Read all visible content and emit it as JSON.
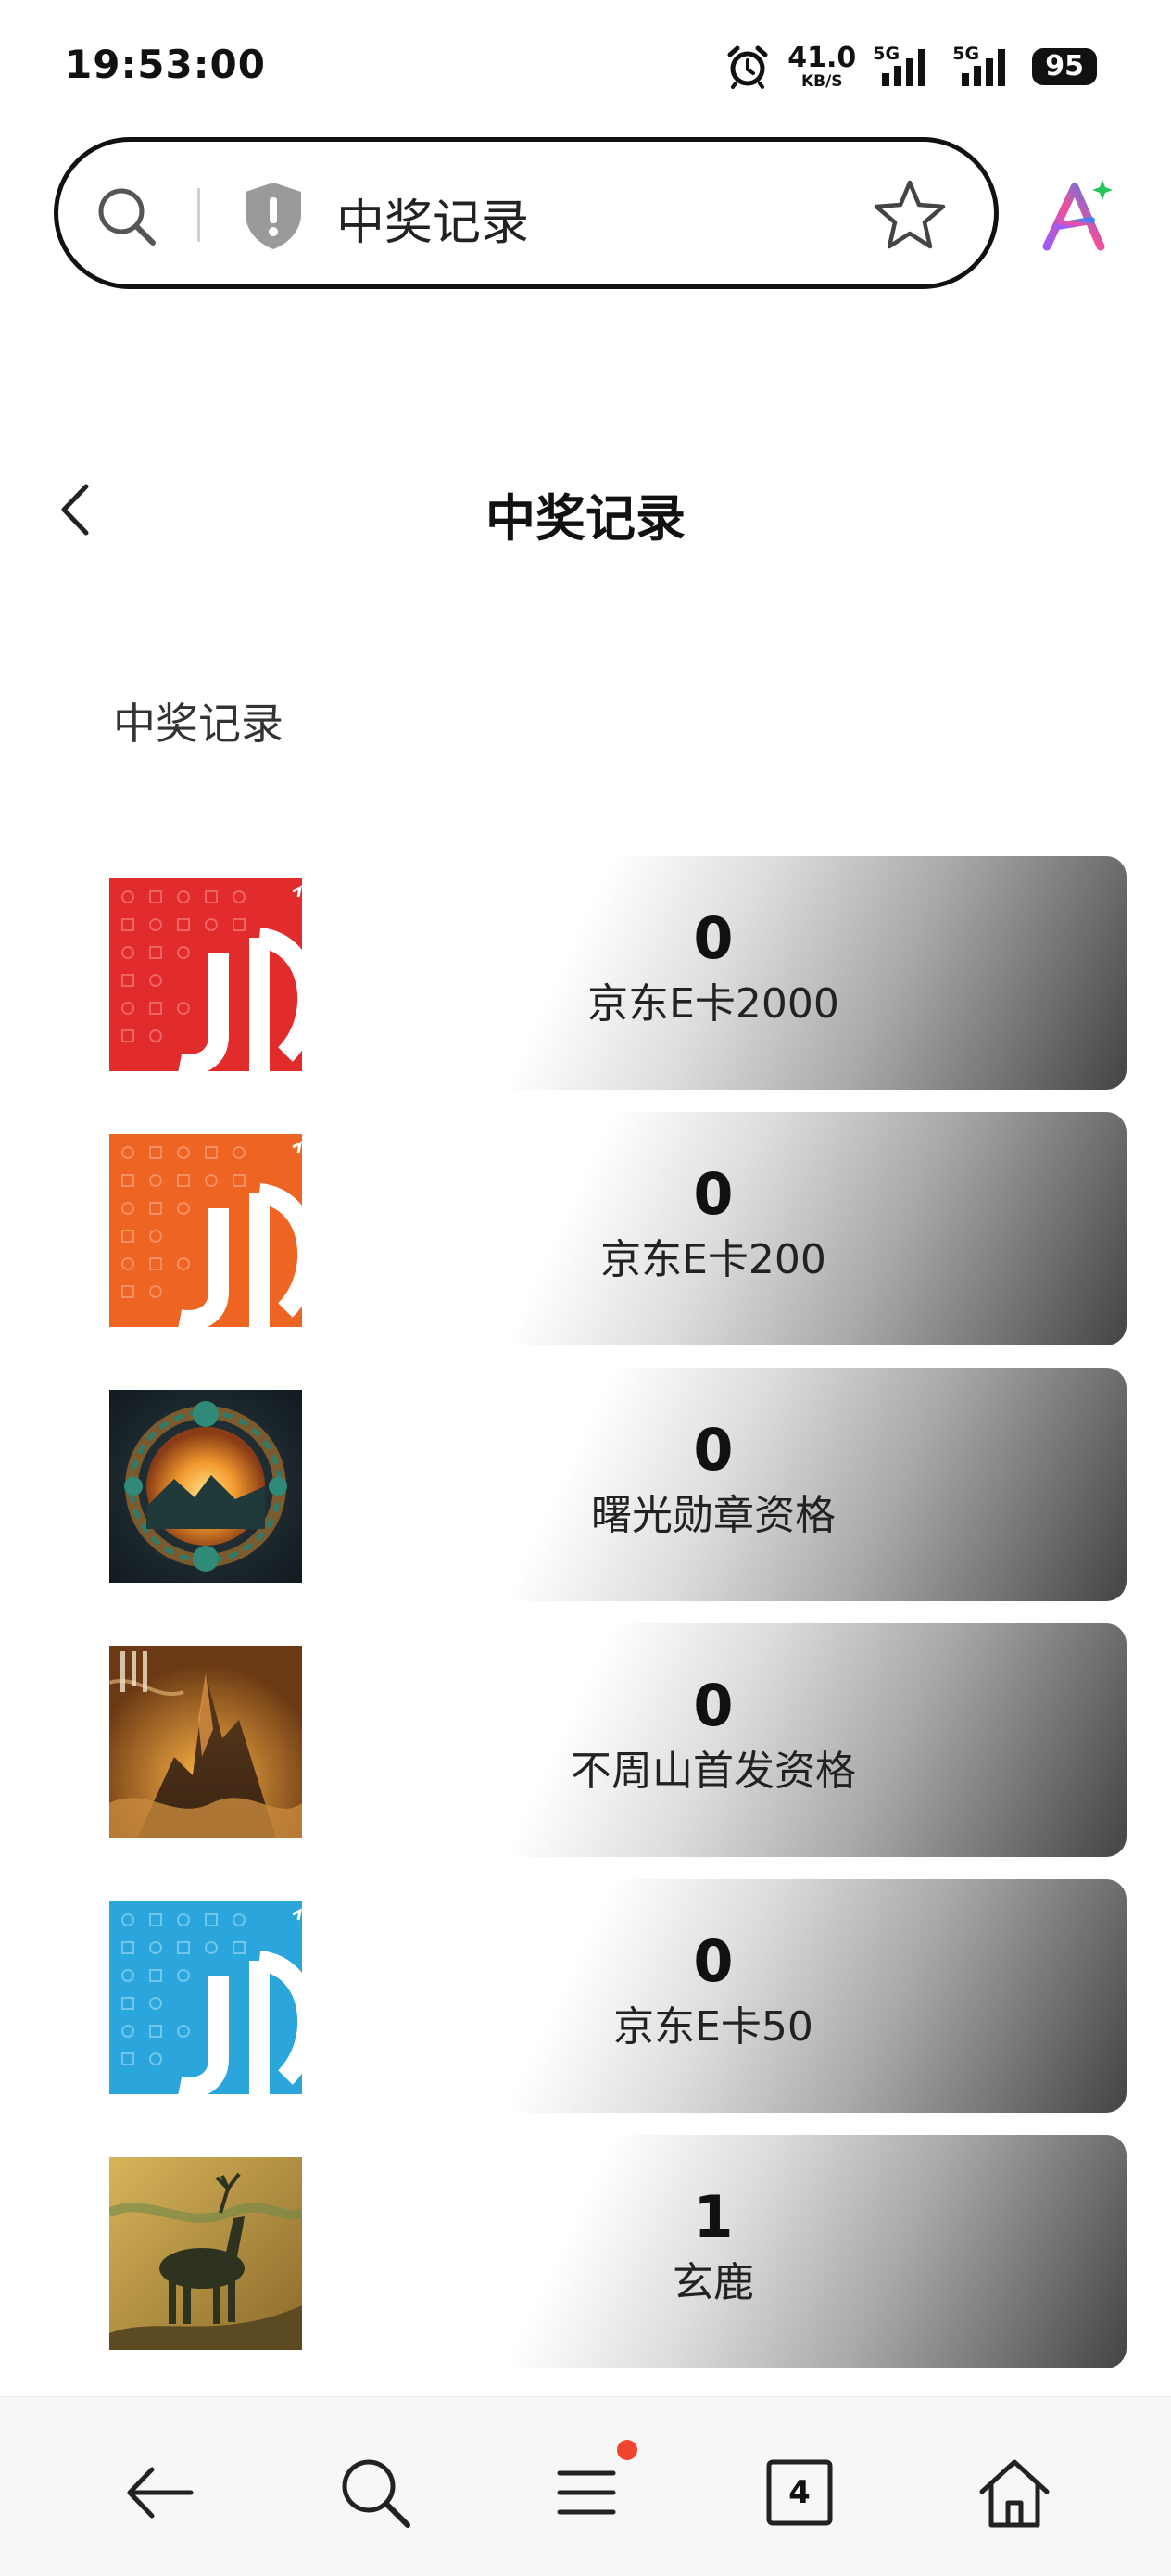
{
  "status_bar": {
    "time": "19:53:00",
    "net_speed": "41.0",
    "net_speed_unit": "KB/S",
    "signal_1": "5G",
    "signal_2": "5G",
    "battery": "95"
  },
  "url_bar": {
    "text": "中奖记录",
    "icons": [
      "search-icon",
      "shield-alert-icon",
      "star-icon",
      "ai-assistant-icon"
    ]
  },
  "header": {
    "title": "中奖记录"
  },
  "section": {
    "title": "中奖记录"
  },
  "prizes": [
    {
      "count": "0",
      "name": "京东E卡2000",
      "image": "jd-card-red"
    },
    {
      "count": "0",
      "name": "京东E卡200",
      "image": "jd-card-orange"
    },
    {
      "count": "0",
      "name": "曙光勋章资格",
      "image": "sunrise-medal-art"
    },
    {
      "count": "0",
      "name": "不周山首发资格",
      "image": "buzhou-mountain-art"
    },
    {
      "count": "0",
      "name": "京东E卡50",
      "image": "jd-card-blue"
    },
    {
      "count": "1",
      "name": "玄鹿",
      "image": "black-deer-art"
    }
  ],
  "colors": {
    "jd_red": "#e22b2b",
    "jd_orange": "#ee6422",
    "jd_blue": "#2aa6dc",
    "notification_dot": "#f0442e"
  },
  "bottom_nav": {
    "items": [
      "back-icon",
      "search-icon",
      "menu-icon",
      "tabs-icon",
      "home-icon"
    ],
    "tab_count": "4"
  }
}
